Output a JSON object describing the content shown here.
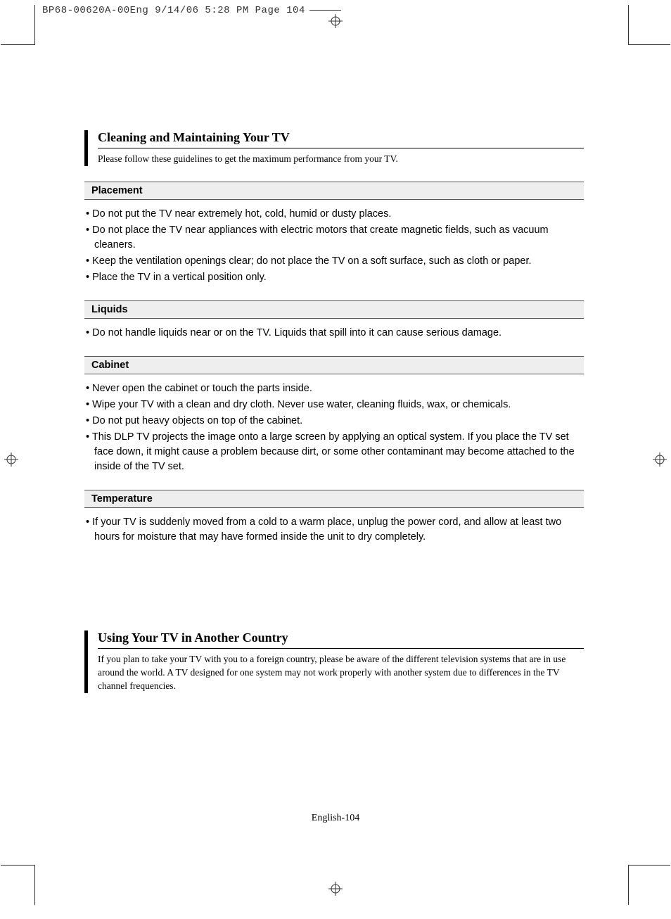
{
  "slug": "BP68-00620A-00Eng  9/14/06  5:28 PM  Page 104",
  "section1": {
    "title": "Cleaning and Maintaining Your TV",
    "subtitle": "Please follow these guidelines to get the maximum performance from your TV."
  },
  "placement": {
    "heading": "Placement",
    "b1": "• Do not put the TV near extremely hot, cold, humid or dusty places.",
    "b2": "• Do not place the TV near appliances with electric motors that create magnetic fields, such as vacuum cleaners.",
    "b3": "• Keep the ventilation openings clear; do not place the TV on a soft surface, such as cloth or paper.",
    "b4": "• Place the TV in a vertical position only."
  },
  "liquids": {
    "heading": "Liquids",
    "b1": "• Do not handle liquids near or on the TV. Liquids that spill into it can cause serious damage."
  },
  "cabinet": {
    "heading": "Cabinet",
    "b1": "• Never open the cabinet or touch the parts inside.",
    "b2": "• Wipe your TV with a clean and dry cloth. Never use water, cleaning fluids, wax, or chemicals.",
    "b3": "• Do not put heavy objects on top of the cabinet.",
    "b4": "• This DLP TV projects the image onto a large screen by applying an optical system. If you place the TV set face down, it might cause a problem because dirt, or some other contaminant may become attached to the inside of the TV set."
  },
  "temperature": {
    "heading": "Temperature",
    "b1": "• If your TV is suddenly moved from a cold to a warm place, unplug the power cord, and allow at least two hours for moisture that may have formed inside the unit to dry completely."
  },
  "section2": {
    "title": "Using Your TV in Another Country",
    "subtitle": "If you plan to take your TV with you to a foreign country, please be aware of the different television systems that are in use around the world. A TV designed for one system may not work properly with another system due to differences in the TV channel frequencies."
  },
  "footer": "English-104"
}
